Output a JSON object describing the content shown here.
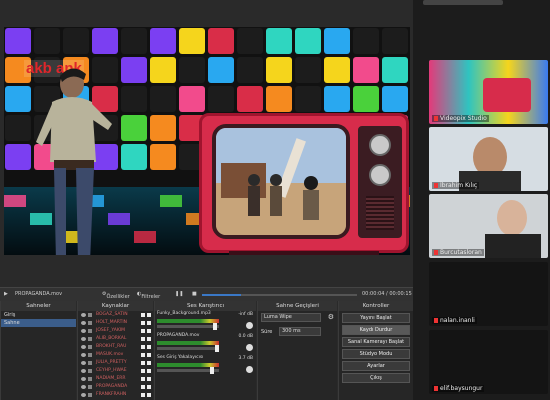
{
  "preview": {
    "brand_text": "akb    ank"
  },
  "player": {
    "media_name": "PROPAGANDA.mov",
    "props_label": "Özellikler",
    "filters_label": "Filtreler",
    "time": "00:00:04  /  00:00:15"
  },
  "docks": {
    "scenes": {
      "title": "Sahneler",
      "items": [
        "Giriş",
        "Sahne"
      ]
    },
    "sources": {
      "title": "Kaynaklar",
      "items": [
        "BOGAZ_SATIN",
        "HOLT_MARTIN",
        "JOSEF_YAKIM",
        "ALIB_BORKAL",
        "BROKHT_RAU",
        "MASUK.mov",
        "JULIA_PRETTY",
        "CEYHP_HWAE",
        "NADIAM_ERR",
        "PROPAGANDA",
        "FRANKFRAHN"
      ]
    },
    "mixer": {
      "title": "Ses Karıştırıcı",
      "channels": [
        {
          "name": "Funky_Background.mp3",
          "db": "-inf dB"
        },
        {
          "name": "PROPAGANDA.mov",
          "db": "0.0 dB"
        },
        {
          "name": "Ses Giriş Yakalayıcısı",
          "db": "3.7 dB"
        }
      ]
    },
    "transitions": {
      "title": "Sahne Geçişleri",
      "type": "Luma Wipe",
      "duration_label": "Süre",
      "duration": "300 ms"
    },
    "controls": {
      "title": "Kontroller",
      "buttons": [
        "Yayını Başlat",
        "Kaydı Durdur",
        "Sanal Kamerayı Başlat",
        "Stüdyo Modu",
        "Ayarlar",
        "Çıkış"
      ]
    }
  },
  "call": {
    "top_label": "Videopix Studio",
    "participants": [
      {
        "name": "Videopix Studio"
      },
      {
        "name": "İbrahim Kılıç"
      },
      {
        "name": "Burcutasloran"
      },
      {
        "name": "nalan.inanli"
      },
      {
        "name": "elif.baysungur"
      }
    ]
  },
  "colors": {
    "tile_palette": [
      "#f24b8c",
      "#2fd6c0",
      "#f5d51c",
      "#29a8f0",
      "#7b3ff2",
      "#d92d48",
      "#4ad13b",
      "#f58a1f",
      "#ffffff",
      "#1c1c1c"
    ],
    "tv_body": "#d72c4b",
    "selected_row": "#3b5d8a"
  }
}
